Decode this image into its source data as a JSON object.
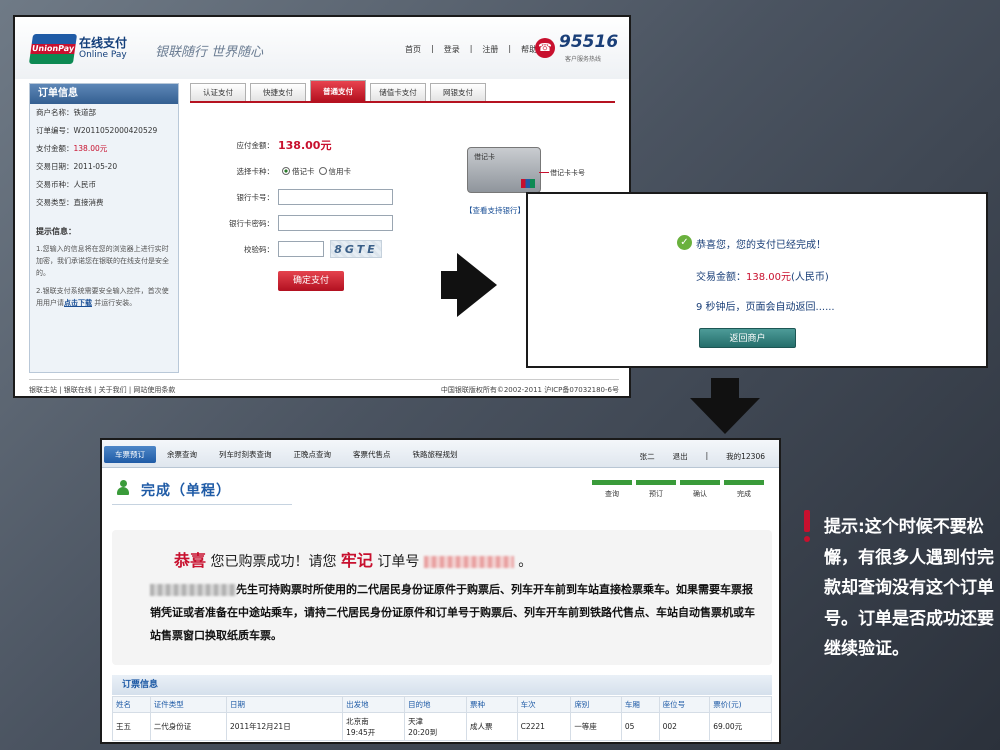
{
  "panel1": {
    "brand_name": "在线支付",
    "brand_sub": "Online Pay",
    "logo_text": "UnionPay 银联",
    "slogan": "银联随行 世界随心",
    "top_nav": [
      "首页",
      "|",
      "登录",
      "|",
      "注册",
      "|",
      "帮助"
    ],
    "hotline_number": "95516",
    "hotline_label": "客户服务热线",
    "sidebar_title": "订单信息",
    "order_info": {
      "merchant": "商户名称：铁道部",
      "order_no": "订单编号：W2011052000420529",
      "amount_label": "支付金额：",
      "amount_value": "138.00元",
      "date": "交易日期：2011-05-20",
      "currency": "交易币种：人民币",
      "type": "交易类型：直接消费"
    },
    "tips_title": "提示信息：",
    "tip1": "1.您输入的信息将在您的浏览器上进行实时加密，我们承诺您在银联的在线支付是安全的。",
    "tip2_a": "2.银联支付系统需要安全输入控件，首次使用用户请",
    "tip2_link": "点击下载",
    "tip2_b": "并运行安装。",
    "tabs": [
      "认证支付",
      "快捷支付",
      "普通支付",
      "储值卡支付",
      "网银支付"
    ],
    "form": {
      "amount_label": "应付金额：",
      "amount_value": "138.00元",
      "card_type_label": "选择卡种：",
      "card_opt1": "借记卡",
      "card_opt2": "信用卡",
      "card_no_label": "银行卡号：",
      "pwd_label": "银行卡密码：",
      "captcha_label": "校验码：",
      "captcha_text": "8GTE",
      "submit": "确定支付"
    },
    "card_title": "借记卡",
    "card_annotation": "借记卡卡号",
    "bank_list_link": "【查看支持银行】",
    "footer_left": "银联主站 | 银联在线 | 关于我们 | 网站使用条款",
    "footer_right": "中国银联版权所有©2002-2011 沪ICP备07032180-6号"
  },
  "panel2": {
    "success": "恭喜您，您的支付已经完成！",
    "amount_prefix": "交易金额：",
    "amount_value": "138.00元",
    "amount_suffix": "(人民币)",
    "redirect": "9 秒钟后，页面会自动返回......",
    "back_button": "返回商户"
  },
  "panel3": {
    "nav": [
      "车票预订",
      "余票查询",
      "列车时刻表查询",
      "正晚点查询",
      "客票代售点",
      "铁路旅程规划"
    ],
    "user_name": "张二",
    "logout": "退出",
    "separator": "|",
    "my_account": "我的12306",
    "title": "完成（单程）",
    "steps": [
      "查询",
      "预订",
      "确认",
      "完成"
    ],
    "congrats": "恭喜",
    "success_text": "您已购票成功！请您",
    "remember": "牢记",
    "order_no_label": "订单号",
    "end_mark": "。",
    "notice_text": "先生可持购票时所使用的二代居民身份证原件于购票后、列车开车前到车站直接检票乘车。如果需要车票报销凭证或者准备在中途站乘车，请持二代居民身份证原件和订单号于购票后、列车开车前到铁路代售点、车站自动售票机或车站售票窗口换取纸质车票。",
    "ticket_section": "订票信息",
    "table": {
      "headers": [
        "姓名",
        "证件类型",
        "日期",
        "出发地",
        "目的地",
        "票种",
        "车次",
        "席别",
        "车厢",
        "座位号",
        "票价(元)"
      ],
      "rows": [
        [
          "王五",
          "二代身份证",
          "2011年12月21日",
          "北京南\n19:45开",
          "天津\n20:20到",
          "成人票",
          "C2221",
          "一等座",
          "05",
          "002",
          "69.00元"
        ]
      ]
    }
  },
  "tip_text": "提示:这个时候不要松懈，有很多人遇到付完款却查询没有这个订单号。订单是否成功还要继续验证。"
}
